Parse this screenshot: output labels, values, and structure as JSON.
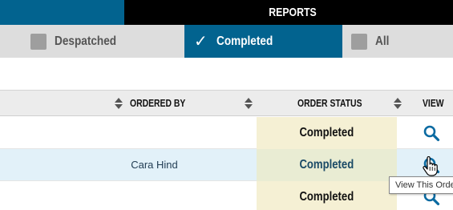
{
  "header": {
    "title": "REPORTS"
  },
  "tabs": [
    {
      "label": "Despatched",
      "checked": false
    },
    {
      "label": "Completed",
      "checked": true,
      "check_glyph": "✓"
    },
    {
      "label": "All",
      "checked": false
    }
  ],
  "table": {
    "columns": [
      "ORDERED BY",
      "ORDER STATUS",
      "VIEW"
    ],
    "rows": [
      {
        "ordered_by": "",
        "status": "Completed",
        "view_icon": "search-icon"
      },
      {
        "ordered_by": "Cara Hind",
        "status": "Completed",
        "view_icon": "search-icon"
      },
      {
        "ordered_by": "",
        "status": "Completed",
        "view_icon": "search-icon"
      }
    ]
  },
  "tooltip": {
    "text": "View This Order"
  },
  "colors": {
    "accent": "#02638f",
    "topbar": "#000000",
    "tab_bg": "#dddddd",
    "status_bg": "#f5f0d4",
    "hover_row": "#e2f1f9",
    "icon": "#0a6aa1"
  }
}
